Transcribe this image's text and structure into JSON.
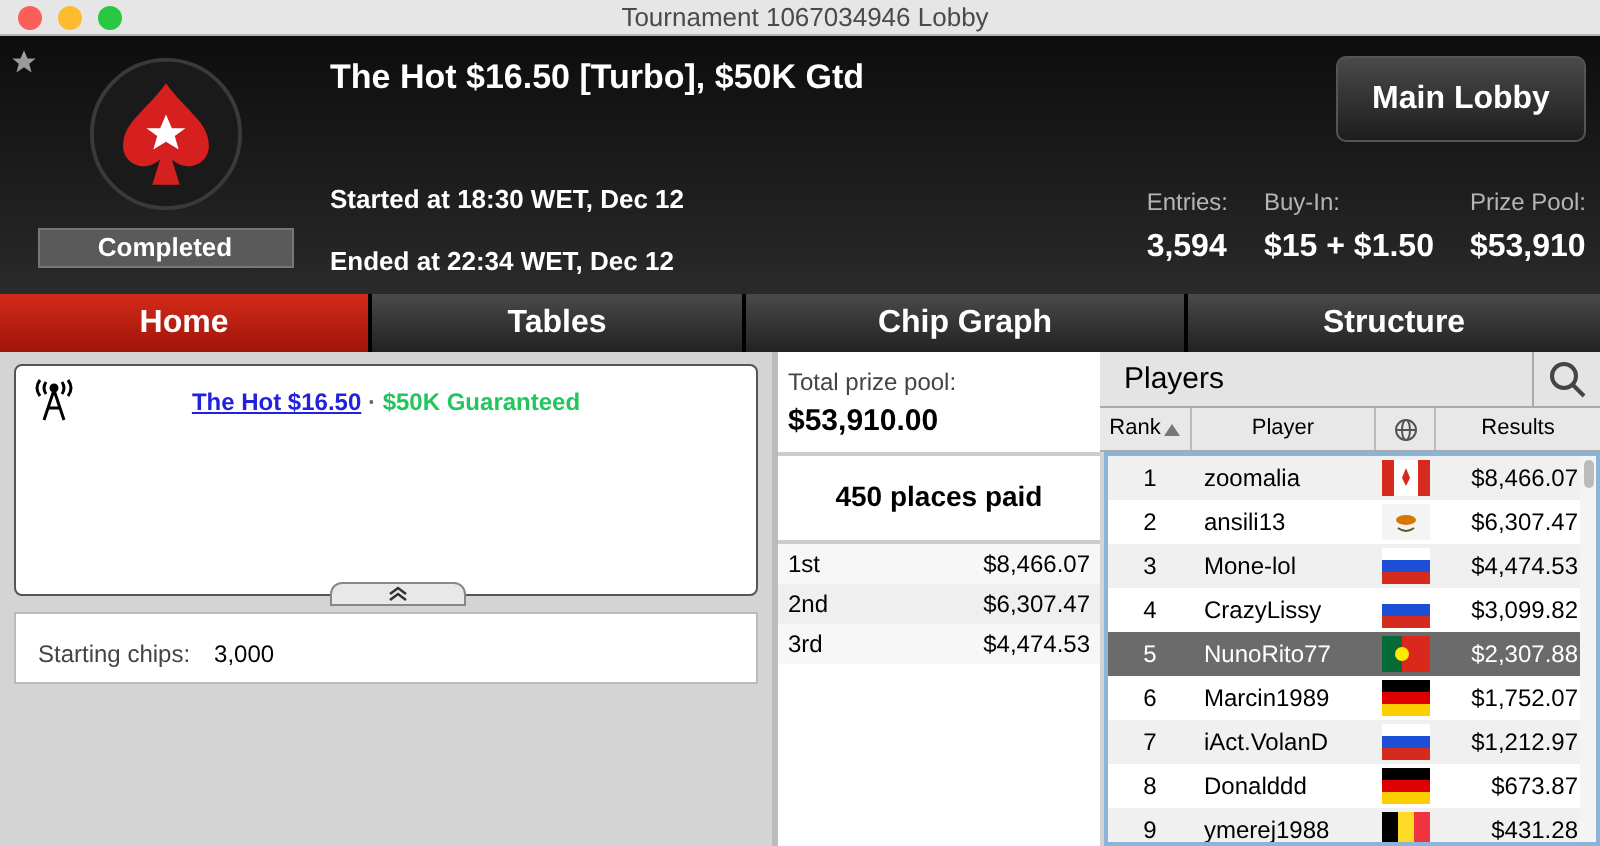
{
  "window": {
    "title": "Tournament 1067034946 Lobby"
  },
  "header": {
    "status": "Completed",
    "title": "The Hot $16.50 [Turbo], $50K Gtd",
    "started": "Started at 18:30 WET, Dec 12",
    "ended": "Ended at 22:34 WET, Dec 12",
    "main_lobby": "Main Lobby",
    "stats": [
      {
        "label": "Entries:",
        "value": "3,594"
      },
      {
        "label": "Buy-In:",
        "value": "$15 + $1.50"
      },
      {
        "label": "Prize Pool:",
        "value": "$53,910"
      }
    ]
  },
  "tabs": [
    {
      "label": "Home",
      "selected": true
    },
    {
      "label": "Tables",
      "selected": false
    },
    {
      "label": "Chip Graph",
      "selected": false
    },
    {
      "label": "Structure",
      "selected": false
    }
  ],
  "info": {
    "link": "The Hot $16.50",
    "separator": "·",
    "guarantee": "$50K Guaranteed",
    "starting_chips_label": "Starting chips:",
    "starting_chips": "3,000"
  },
  "prizes": {
    "total_label": "Total prize pool:",
    "total": "$53,910.00",
    "places_paid": "450 places paid",
    "rows": [
      {
        "place": "1st",
        "amount": "$8,466.07"
      },
      {
        "place": "2nd",
        "amount": "$6,307.47"
      },
      {
        "place": "3rd",
        "amount": "$4,474.53"
      }
    ]
  },
  "players": {
    "title": "Players",
    "columns": [
      "Rank",
      "Player",
      "Results"
    ],
    "rows": [
      {
        "rank": "1",
        "name": "zoomalia",
        "kind": "ca",
        "result": "$8,466.07",
        "selected": false
      },
      {
        "rank": "2",
        "name": "ansili13",
        "kind": "cy",
        "result": "$6,307.47",
        "selected": false
      },
      {
        "rank": "3",
        "name": "Mone-lol",
        "kind": "ru",
        "result": "$4,474.53",
        "selected": false
      },
      {
        "rank": "4",
        "name": "CrazyLissy",
        "kind": "ru",
        "result": "$3,099.82",
        "selected": false
      },
      {
        "rank": "5",
        "name": "NunoRito77",
        "kind": "pt",
        "result": "$2,307.88",
        "selected": true
      },
      {
        "rank": "6",
        "name": "Marcin1989",
        "kind": "de",
        "result": "$1,752.07",
        "selected": false
      },
      {
        "rank": "7",
        "name": "iAct.VolanD",
        "kind": "ru",
        "result": "$1,212.97",
        "selected": false
      },
      {
        "rank": "8",
        "name": "Donalddd",
        "kind": "de",
        "result": "$673.87",
        "selected": false
      },
      {
        "rank": "9",
        "name": "ymerej1988",
        "kind": "be",
        "result": "$431.28",
        "selected": false
      }
    ]
  }
}
